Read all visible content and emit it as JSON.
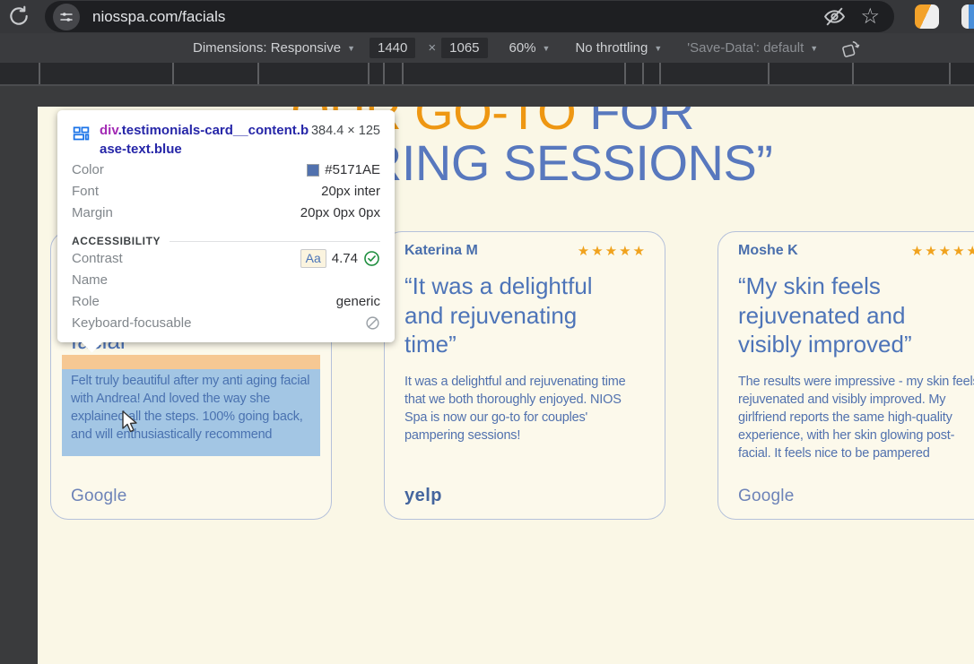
{
  "colors": {
    "accent_orange": "#EE9712",
    "accent_blue": "#5878BE",
    "body_text_blue": "#5171AE",
    "star_orange": "#F0A21D",
    "highlight_margin": "#F6C893",
    "highlight_content": "#A3C6E4",
    "contrast_ok_green": "#1E8E3E"
  },
  "icons": {
    "caret": "▼",
    "star_outline": "☆",
    "star_filled": "★"
  },
  "browser": {
    "url": "niosspa.com/facials"
  },
  "devtoolbar": {
    "dimensions_label": "Dimensions: Responsive",
    "width": "1440",
    "times": "×",
    "height": "1065",
    "zoom": "60%",
    "throttling": "No throttling",
    "save_data": "'Save-Data': default"
  },
  "tooltip": {
    "selector_tag": "div",
    "selector_classes": ".testimonials-card__content.base-text.blue",
    "dimensions": "384.4 × 125",
    "color_label": "Color",
    "color_value": "#5171AE",
    "font_label": "Font",
    "font_value": "20px inter",
    "margin_label": "Margin",
    "margin_value": "20px 0px 0px",
    "accessibility": {
      "title": "ACCESSIBILITY",
      "contrast_label": "Contrast",
      "contrast_badge": "Aa",
      "contrast_value": "4.74",
      "name_label": "Name",
      "role_label": "Role",
      "role_value": "generic",
      "keyboard_label": "Keyboard-focusable"
    }
  },
  "page": {
    "heading": {
      "orange_part": "“OUR GO-TO",
      "blue_part": " FOR",
      "line2": "PAMPERING SESSIONS”"
    },
    "cards": [
      {
        "quote_clipped": "facial",
        "body": "Felt truly beautiful after my anti aging facial with Andrea! And loved the way she explained all the steps. 100% going back, and will enthusiastically recommend",
        "source": "Google"
      },
      {
        "name": "Katerina M",
        "stars": "★★★★★",
        "quote": "“It was a delightful and rejuvenating time”",
        "body": "It was a delightful and rejuvenating time that we both thoroughly enjoyed. NIOS Spa is now our go-to for couples' pampering sessions!",
        "source": "yelp"
      },
      {
        "name": "Moshe K",
        "stars": "★★★★★",
        "quote": "“My skin feels rejuvenated and visibly improved”",
        "body": "The results were impressive - my skin feels rejuvenated and visibly improved. My girlfriend reports the same high-quality experience, with her skin glowing post-facial. It feels nice to be pampered",
        "source": "Google"
      }
    ]
  }
}
